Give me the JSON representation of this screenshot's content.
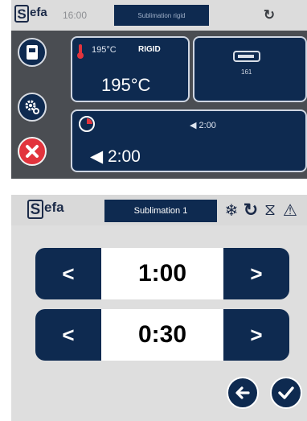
{
  "screen1": {
    "header": {
      "logo_initial": "S",
      "logo_rest": "efa",
      "time": "16:00",
      "tab_label": "Sublimation rigid",
      "refresh_icon": "refresh-icon"
    },
    "sidebar": {
      "program_icon": "program-icon",
      "settings_icon": "gear-icon",
      "stop_icon": "close-icon"
    },
    "temperature_panel": {
      "setpoint": "195°C",
      "material": "RIGID",
      "value": "195°C"
    },
    "mode_panel": {
      "value": "161"
    },
    "time_panel": {
      "setpoint": "◀ 2:00",
      "value": "◀  2:00"
    },
    "colors": {
      "navy": "#0e2a50",
      "red": "#e2343d",
      "grey": "#4a4d52"
    }
  },
  "screen2": {
    "header": {
      "logo_initial": "S",
      "logo_rest": "efa",
      "tab_label": "Sublimation 1",
      "snow_icon": "❄",
      "refresh_icon": "↻",
      "hourglass_icon": "⧖",
      "warning_icon": "⚠"
    },
    "steppers": [
      {
        "decrement": "<",
        "value": "1:00",
        "increment": ">"
      },
      {
        "decrement": "<",
        "value": "0:30",
        "increment": ">"
      }
    ],
    "actions": {
      "back_icon": "arrow-left-icon",
      "confirm_icon": "check-icon"
    }
  }
}
